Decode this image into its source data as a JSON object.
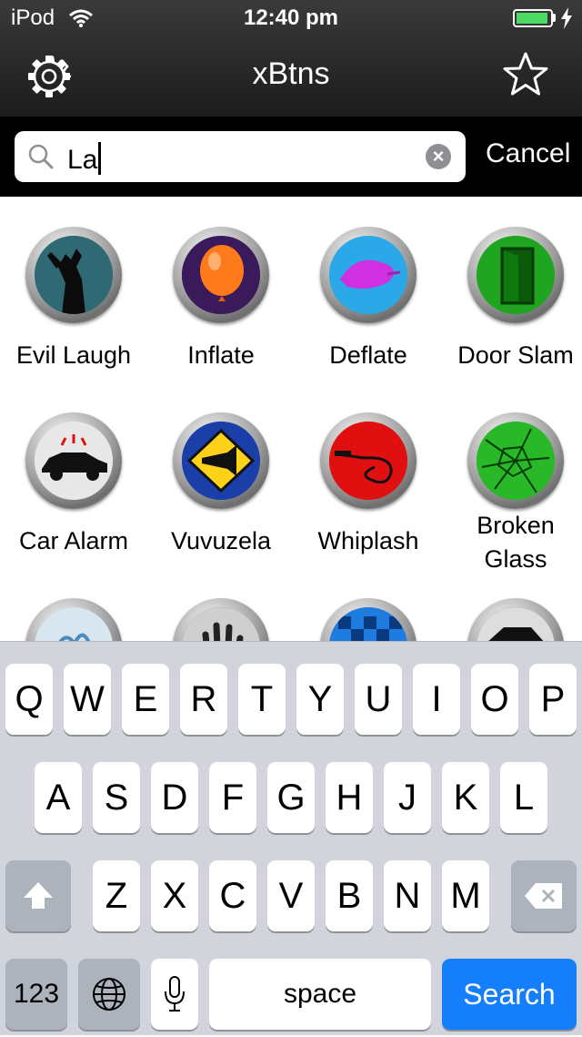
{
  "status_bar": {
    "carrier": "iPod",
    "time": "12:40 pm",
    "battery_level": 0.95
  },
  "nav": {
    "title": "xBtns",
    "settings_icon": "gear-icon",
    "favorites_icon": "star-icon"
  },
  "search": {
    "value": "La",
    "cancel_label": "Cancel"
  },
  "buttons": [
    {
      "label": "Evil Laugh",
      "icon": "silhouette-icon",
      "color": "#2b5c66"
    },
    {
      "label": "Inflate",
      "icon": "balloon-icon",
      "color": "#3b1a5c"
    },
    {
      "label": "Deflate",
      "icon": "deflated-balloon-icon",
      "color": "#2aa8e8"
    },
    {
      "label": "Door Slam",
      "icon": "door-icon",
      "color": "#1fa51f"
    },
    {
      "label": "Car Alarm",
      "icon": "car-icon",
      "color": "#d8d8d8"
    },
    {
      "label": "Vuvuzela",
      "icon": "vuvuzela-icon",
      "color": "#1a3fa8"
    },
    {
      "label": "Whiplash",
      "icon": "whip-icon",
      "color": "#e01010"
    },
    {
      "label": "Broken Glass",
      "icon": "cracked-glass-icon",
      "color": "#28b828"
    },
    {
      "label": "",
      "icon": "splash-icon",
      "color": "#6aa3c8"
    },
    {
      "label": "",
      "icon": "handprint-icon",
      "color": "#555555"
    },
    {
      "label": "",
      "icon": "checkered-flag-icon",
      "color": "#1e7be0"
    },
    {
      "label": "",
      "icon": "car-silhouette-icon",
      "color": "#333333"
    }
  ],
  "keyboard": {
    "row1": [
      "Q",
      "W",
      "E",
      "R",
      "T",
      "Y",
      "U",
      "I",
      "O",
      "P"
    ],
    "row2": [
      "A",
      "S",
      "D",
      "F",
      "G",
      "H",
      "J",
      "K",
      "L"
    ],
    "row3": [
      "Z",
      "X",
      "C",
      "V",
      "B",
      "N",
      "M"
    ],
    "numbers_label": "123",
    "space_label": "space",
    "search_label": "Search"
  }
}
